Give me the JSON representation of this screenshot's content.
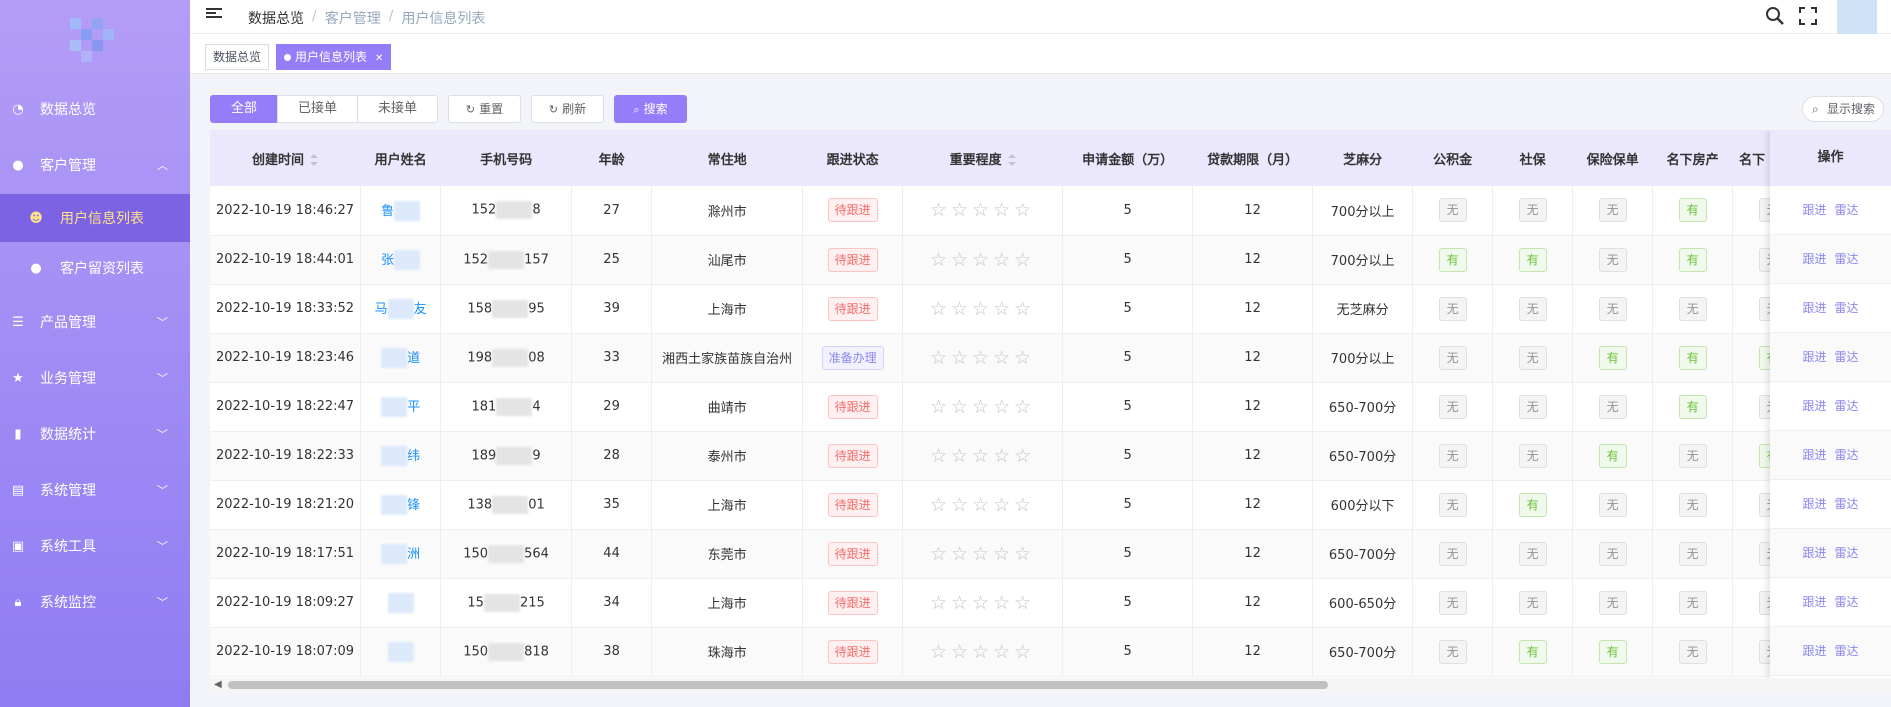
{
  "sidebar": {
    "items": [
      {
        "label": "数据总览",
        "icon": "dashboard-icon"
      },
      {
        "label": "客户管理",
        "icon": "user-icon",
        "expanded": true
      },
      {
        "label": "用户信息列表",
        "icon": "user-card-icon",
        "active": true
      },
      {
        "label": "客户留资列表",
        "icon": "user-icon"
      },
      {
        "label": "产品管理",
        "icon": "list-icon"
      },
      {
        "label": "业务管理",
        "icon": "star-icon"
      },
      {
        "label": "数据统计",
        "icon": "bar-chart-icon"
      },
      {
        "label": "系统管理",
        "icon": "system-icon"
      },
      {
        "label": "系统工具",
        "icon": "toolbox-icon"
      },
      {
        "label": "系统监控",
        "icon": "lock-icon"
      }
    ]
  },
  "header": {
    "breadcrumb": [
      "数据总览",
      "客户管理",
      "用户信息列表"
    ]
  },
  "tags": [
    {
      "label": "数据总览"
    },
    {
      "label": "用户信息列表",
      "active": true
    }
  ],
  "toolbar": {
    "segments": [
      "全部",
      "已接单",
      "未接单"
    ],
    "reset_label": "重置",
    "refresh_label": "刷新",
    "search_label": "搜索",
    "show_search_label": "显示搜索"
  },
  "table": {
    "headers": [
      "创建时间",
      "用户姓名",
      "手机号码",
      "年龄",
      "常住地",
      "跟进状态",
      "重要程度",
      "申请金额（万）",
      "贷款期限（月）",
      "芝麻分",
      "公积金",
      "社保",
      "保险保单",
      "名下房产",
      "名下"
    ],
    "op_header": "操作",
    "op_follow": "跟进",
    "op_leida": "雷达",
    "rows": [
      {
        "time": "2022-10-19 18:46:27",
        "name_a": "鲁",
        "name_b": "",
        "phone_a": "152",
        "phone_b": "8",
        "age": "27",
        "city": "滁州市",
        "status": "待跟进",
        "amount": "5",
        "term": "12",
        "zhima": "700分以上",
        "gjj": "无",
        "sb": "无",
        "bx": "无",
        "fc": "有",
        "mx": "无"
      },
      {
        "time": "2022-10-19 18:44:01",
        "name_a": "张",
        "name_b": "",
        "phone_a": "152",
        "phone_b": "157",
        "age": "25",
        "city": "汕尾市",
        "status": "待跟进",
        "amount": "5",
        "term": "12",
        "zhima": "700分以上",
        "gjj": "有",
        "sb": "有",
        "bx": "无",
        "fc": "有",
        "mx": "无"
      },
      {
        "time": "2022-10-19 18:33:52",
        "name_a": "马",
        "name_b": "友",
        "phone_a": "158",
        "phone_b": "95",
        "age": "39",
        "city": "上海市",
        "status": "待跟进",
        "amount": "5",
        "term": "12",
        "zhima": "无芝麻分",
        "gjj": "无",
        "sb": "无",
        "bx": "无",
        "fc": "无",
        "mx": "无"
      },
      {
        "time": "2022-10-19 18:23:46",
        "name_a": "",
        "name_b": "道",
        "phone_a": "198",
        "phone_b": "08",
        "age": "33",
        "city": "湘西土家族苗族自治州",
        "status": "准备办理",
        "amount": "5",
        "term": "12",
        "zhima": "700分以上",
        "gjj": "无",
        "sb": "无",
        "bx": "有",
        "fc": "有",
        "mx": "有"
      },
      {
        "time": "2022-10-19 18:22:47",
        "name_a": "",
        "name_b": "平",
        "phone_a": "181",
        "phone_b": "4",
        "age": "29",
        "city": "曲靖市",
        "status": "待跟进",
        "amount": "5",
        "term": "12",
        "zhima": "650-700分",
        "gjj": "无",
        "sb": "无",
        "bx": "无",
        "fc": "有",
        "mx": "无"
      },
      {
        "time": "2022-10-19 18:22:33",
        "name_a": "",
        "name_b": "纬",
        "phone_a": "189",
        "phone_b": "9",
        "age": "28",
        "city": "泰州市",
        "status": "待跟进",
        "amount": "5",
        "term": "12",
        "zhima": "650-700分",
        "gjj": "无",
        "sb": "无",
        "bx": "有",
        "fc": "无",
        "mx": "有"
      },
      {
        "time": "2022-10-19 18:21:20",
        "name_a": "",
        "name_b": "锋",
        "phone_a": "138",
        "phone_b": "01",
        "age": "35",
        "city": "上海市",
        "status": "待跟进",
        "amount": "5",
        "term": "12",
        "zhima": "600分以下",
        "gjj": "无",
        "sb": "有",
        "bx": "无",
        "fc": "无",
        "mx": "无"
      },
      {
        "time": "2022-10-19 18:17:51",
        "name_a": "",
        "name_b": "洲",
        "phone_a": "150",
        "phone_b": "564",
        "age": "44",
        "city": "东莞市",
        "status": "待跟进",
        "amount": "5",
        "term": "12",
        "zhima": "650-700分",
        "gjj": "无",
        "sb": "无",
        "bx": "无",
        "fc": "无",
        "mx": "无"
      },
      {
        "time": "2022-10-19 18:09:27",
        "name_a": "",
        "name_b": "",
        "phone_a": "15",
        "phone_b": "215",
        "age": "34",
        "city": "上海市",
        "status": "待跟进",
        "amount": "5",
        "term": "12",
        "zhima": "600-650分",
        "gjj": "无",
        "sb": "无",
        "bx": "无",
        "fc": "无",
        "mx": "无"
      },
      {
        "time": "2022-10-19 18:07:09",
        "name_a": "",
        "name_b": "",
        "phone_a": "150",
        "phone_b": "818",
        "age": "38",
        "city": "珠海市",
        "status": "待跟进",
        "amount": "5",
        "term": "12",
        "zhima": "650-700分",
        "gjj": "无",
        "sb": "有",
        "bx": "有",
        "fc": "无",
        "mx": "无"
      }
    ]
  },
  "colors": {
    "accent": "#957dfa",
    "sidebar_top": "#b39df7",
    "sidebar_bottom": "#8f7cf2",
    "active_text": "#ffe18a"
  }
}
